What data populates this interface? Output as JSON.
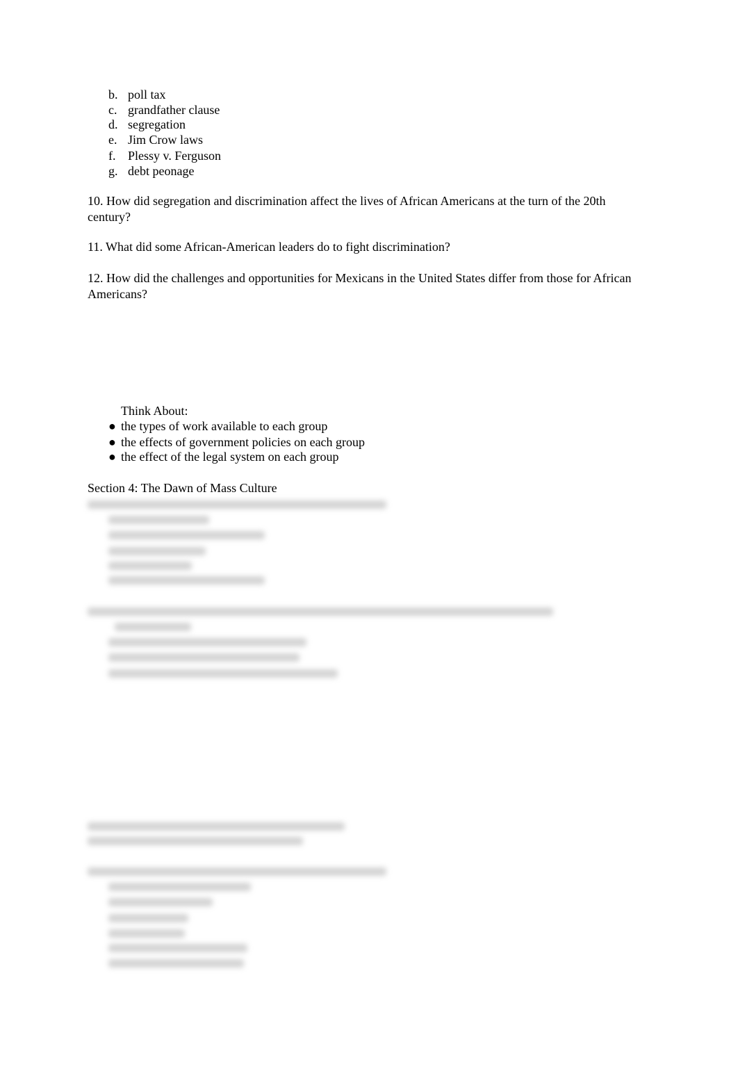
{
  "list_items": [
    {
      "letter": "b.",
      "text": "poll tax"
    },
    {
      "letter": "c.",
      "text": "grandfather clause"
    },
    {
      "letter": "d.",
      "text": "segregation"
    },
    {
      "letter": "e.",
      "text": "Jim Crow laws"
    },
    {
      "letter": "f.",
      "text": "Plessy v. Ferguson"
    },
    {
      "letter": "g.",
      "text": "debt peonage"
    }
  ],
  "questions": [
    "10. How did segregation and discrimination affect the lives of African Americans at the turn of the 20th century?",
    "11. What did some African-American leaders do to fight discrimination?",
    "12. How did the challenges and opportunities for Mexicans in the United States differ from those for African Americans?"
  ],
  "think_about": {
    "label": "Think About:",
    "bullet": "●",
    "items": [
      "the types of work available to each group",
      "the effects of government policies on each group",
      "the effect of the legal system on each group"
    ]
  },
  "section_heading": "Section 4: The Dawn of Mass Culture"
}
